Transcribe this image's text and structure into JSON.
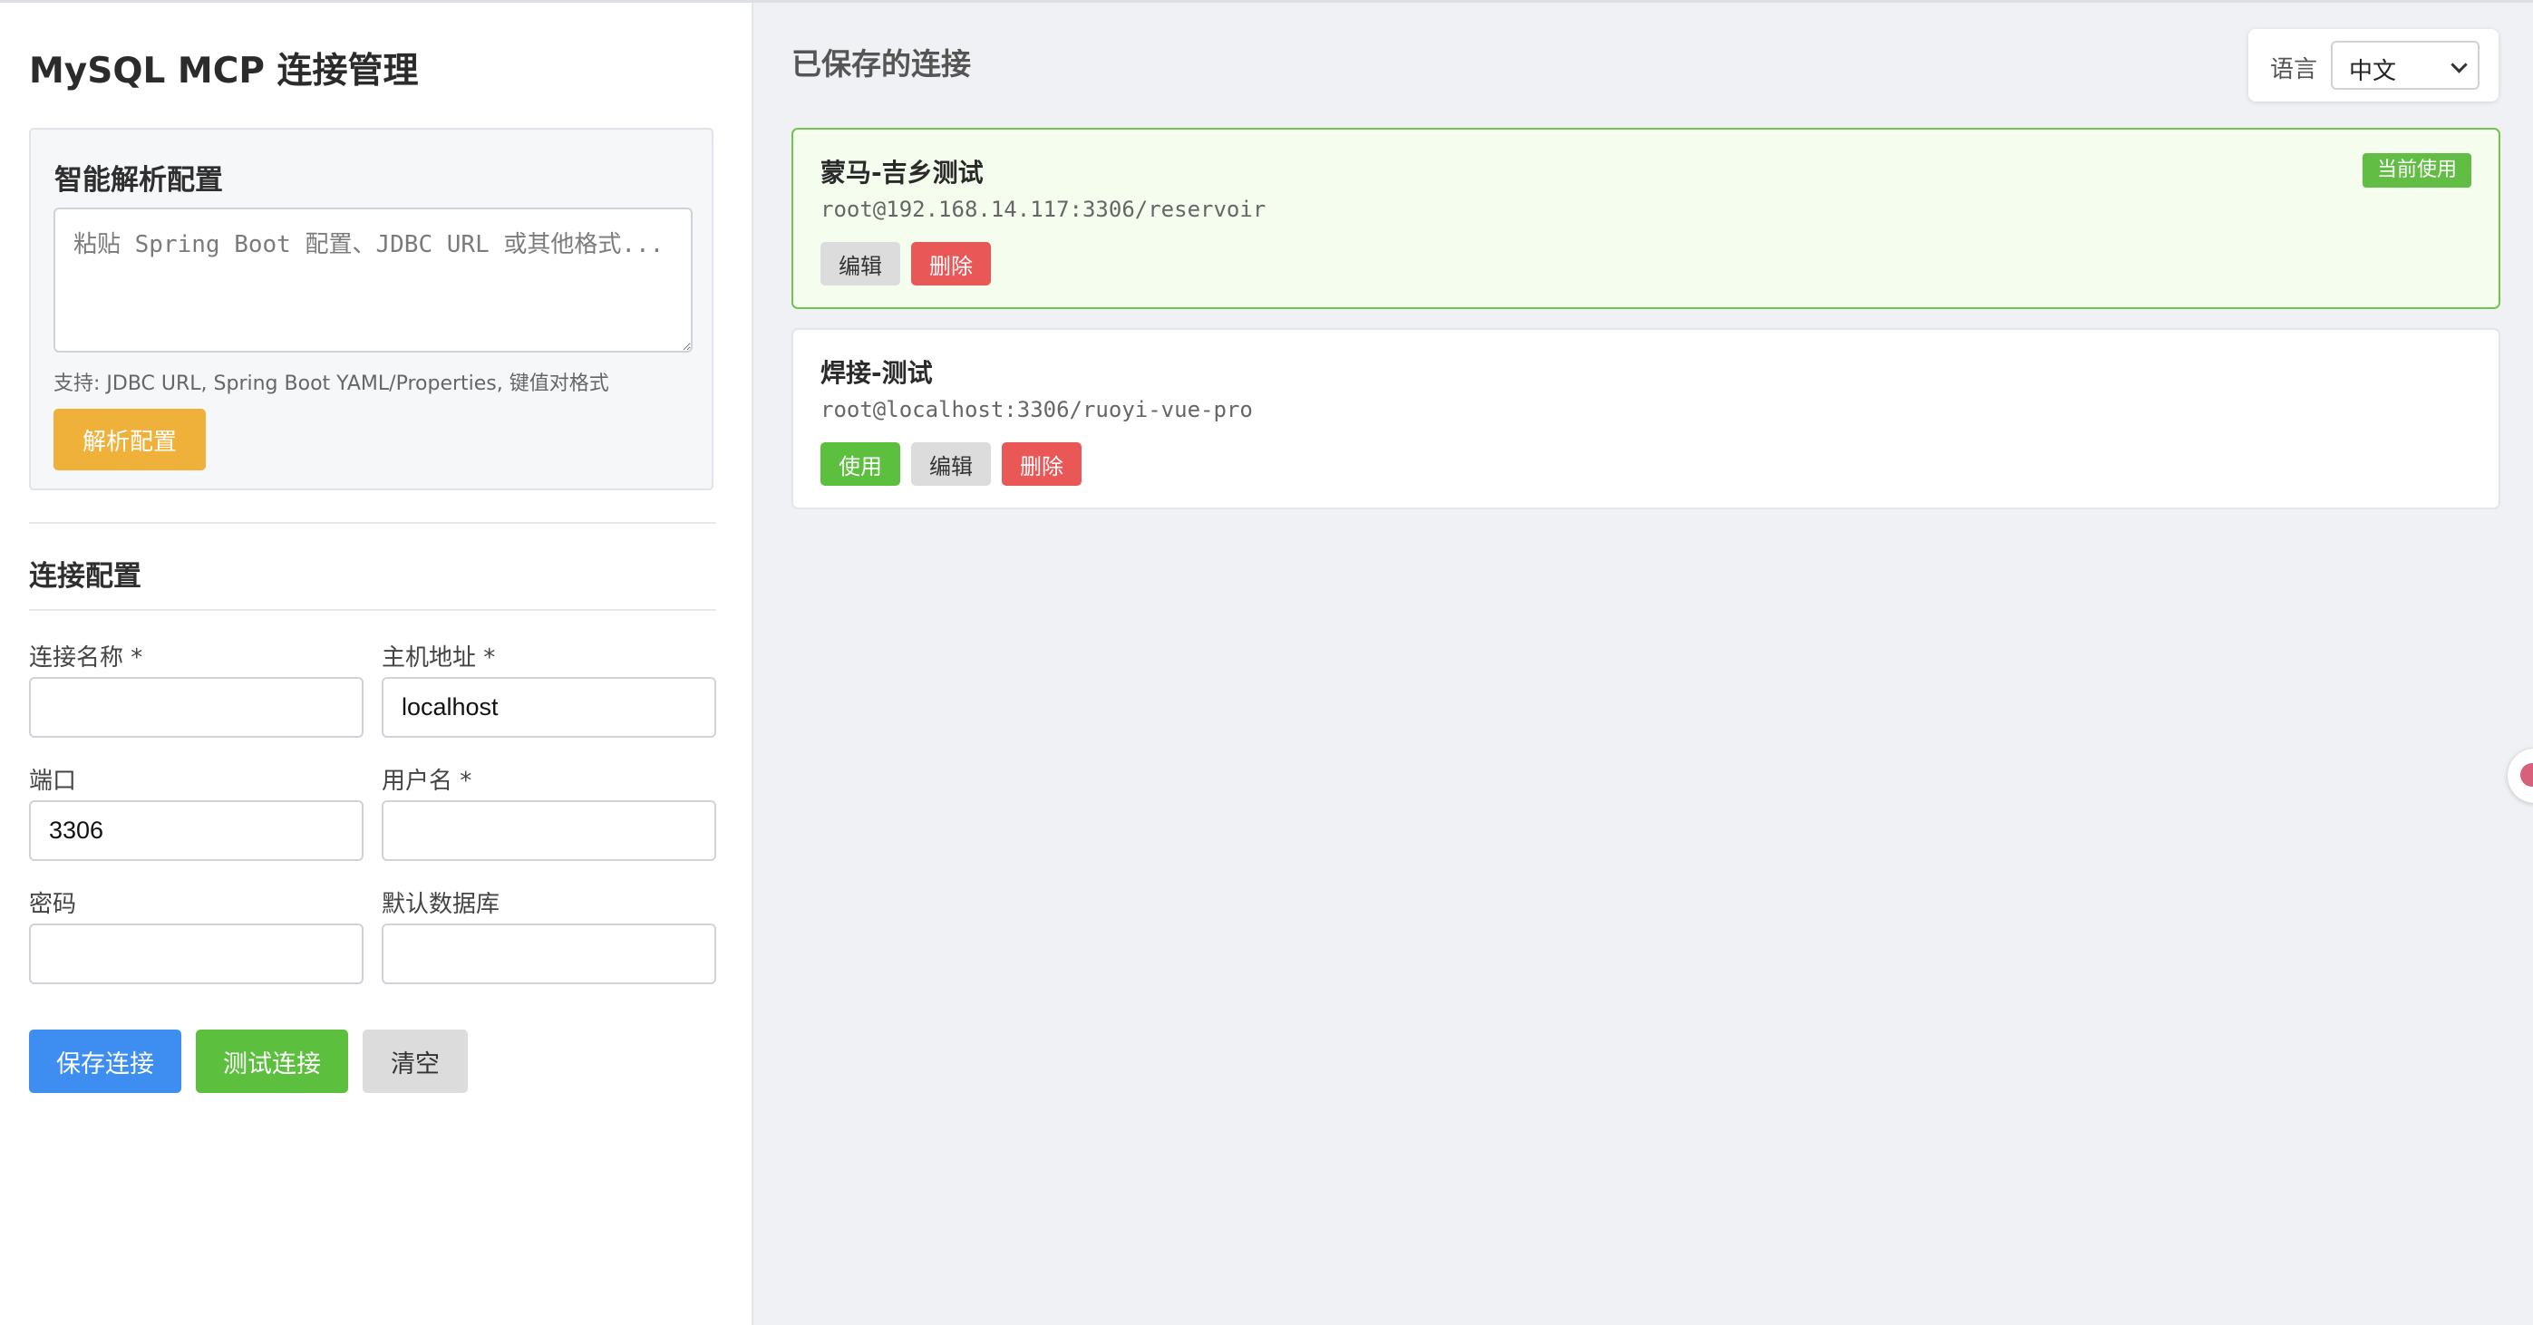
{
  "app": {
    "title": "MySQL MCP 连接管理"
  },
  "parse": {
    "title": "智能解析配置",
    "placeholder": "粘贴 Spring Boot 配置、JDBC URL 或其他格式...",
    "hint": "支持: JDBC URL, Spring Boot YAML/Properties, 键值对格式",
    "button": "解析配置"
  },
  "connection_form": {
    "title": "连接配置",
    "fields": {
      "name": {
        "label": "连接名称 *",
        "value": ""
      },
      "host": {
        "label": "主机地址 *",
        "value": "localhost"
      },
      "port": {
        "label": "端口",
        "value": "3306"
      },
      "username": {
        "label": "用户名 *",
        "value": ""
      },
      "password": {
        "label": "密码",
        "value": ""
      },
      "database": {
        "label": "默认数据库",
        "value": ""
      }
    },
    "buttons": {
      "save": "保存连接",
      "test": "测试连接",
      "clear": "清空"
    }
  },
  "saved": {
    "title": "已保存的连接",
    "language": {
      "label": "语言",
      "selected": "中文"
    },
    "connections": [
      {
        "name": "蒙马-吉乡测试",
        "conn": "root@192.168.14.117:3306/reservoir",
        "active": true,
        "badge": "当前使用",
        "buttons": {
          "edit": "编辑",
          "delete": "删除"
        }
      },
      {
        "name": "焊接-测试",
        "conn": "root@localhost:3306/ruoyi-vue-pro",
        "active": false,
        "buttons": {
          "use": "使用",
          "edit": "编辑",
          "delete": "删除"
        }
      }
    ]
  },
  "colors": {
    "accent_blue": "#3d8ef0",
    "accent_green": "#5cbf3d",
    "accent_orange": "#f0b13a",
    "danger_red": "#ea5757",
    "active_card_border": "#72c44e"
  }
}
